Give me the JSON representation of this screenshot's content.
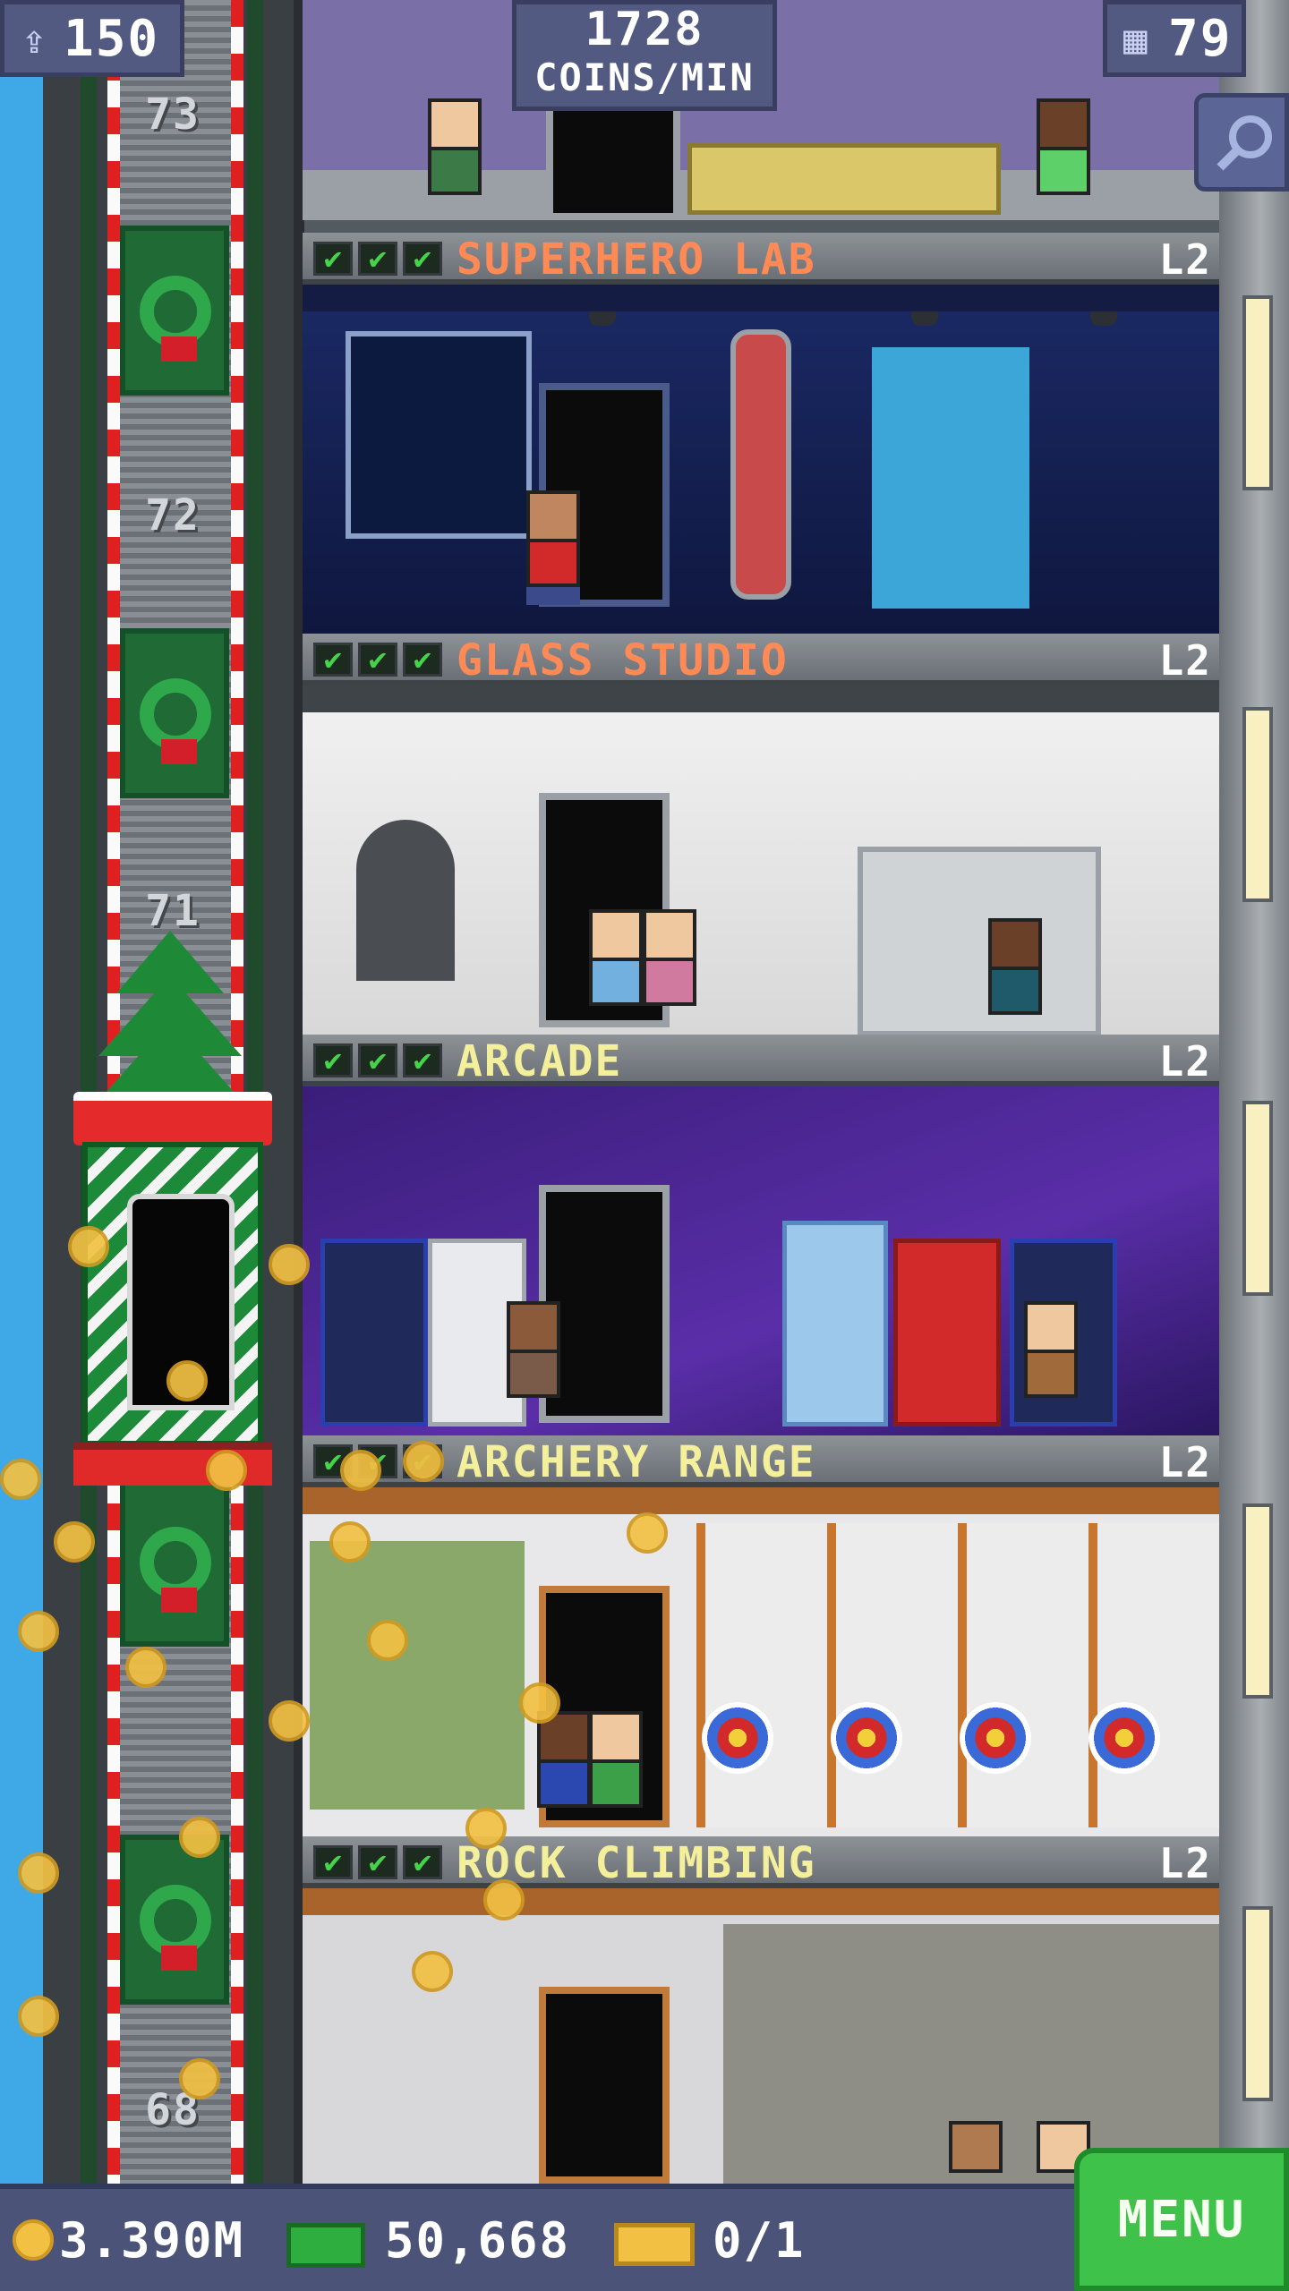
{
  "hud": {
    "bux_count": "150",
    "coins_per_min_value": "1728",
    "coins_per_min_label": "COINS/MIN",
    "floors_count": "79"
  },
  "elevator": {
    "floor_numbers": [
      "73",
      "72",
      "71",
      "68"
    ]
  },
  "floors": [
    {
      "name": "SUPERHERO LAB",
      "level": "L2",
      "name_color": "#ff8a55"
    },
    {
      "name": "GLASS STUDIO",
      "level": "L2",
      "name_color": "#ff8a55"
    },
    {
      "name": "ARCADE",
      "level": "L2",
      "name_color": "#f4ef9a"
    },
    {
      "name": "ARCHERY RANGE",
      "level": "L2",
      "name_color": "#f4ef9a"
    },
    {
      "name": "ROCK CLIMBING",
      "level": "L2",
      "name_color": "#f4ef9a"
    }
  ],
  "status": {
    "coins": "3.390M",
    "bux": "50,668",
    "vip_tickets": "0/1"
  },
  "menu_label": "MENU",
  "colors": {
    "hud_bg": "#525a82",
    "menu_green": "#3ec24a",
    "check_green": "#46d34a",
    "floor_name_orange": "#ff8a55",
    "floor_name_yellow": "#f4ef9a"
  },
  "icons": [
    "bux-icon",
    "floors-icon",
    "zoom-icon",
    "coin-icon",
    "cash-icon",
    "ticket-icon",
    "checkmark-icon"
  ]
}
